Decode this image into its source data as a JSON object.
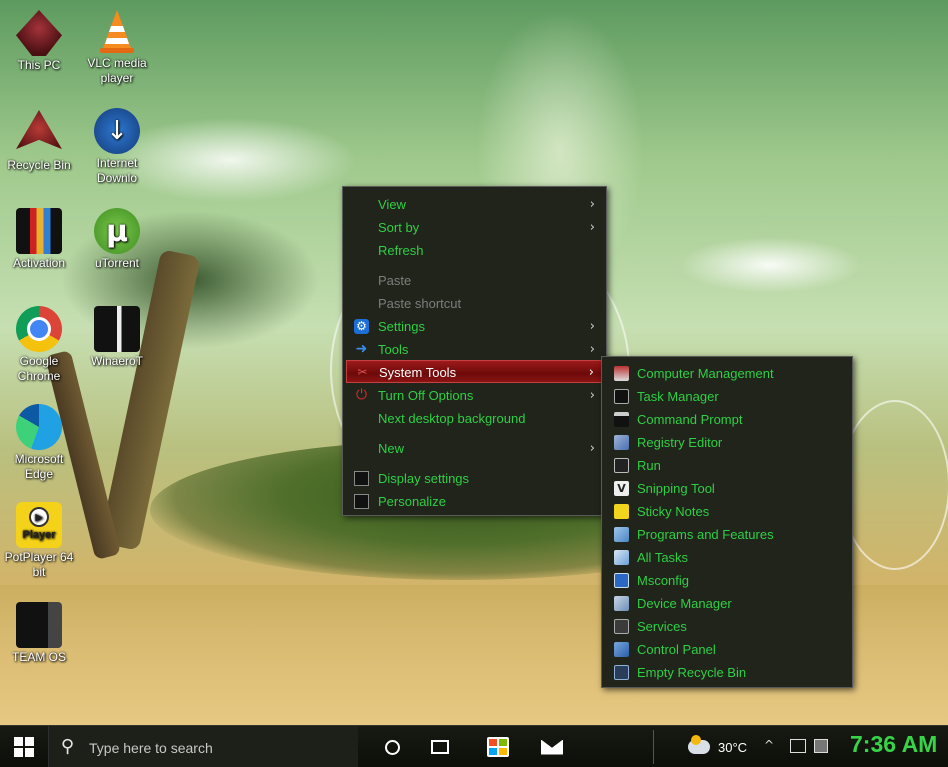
{
  "desktop": {
    "icons": [
      {
        "label": "This PC",
        "icon": "this-pc-icon"
      },
      {
        "label": "VLC media player",
        "icon": "vlc-icon"
      },
      {
        "label": "Recycle Bin",
        "icon": "recycle-bin-icon"
      },
      {
        "label": "Internet Downlo",
        "icon": "internet-download-manager-icon"
      },
      {
        "label": "Activation",
        "icon": "activation-icon"
      },
      {
        "label": "uTorrent",
        "icon": "utorrent-icon"
      },
      {
        "label": "Google Chrome",
        "icon": "chrome-icon"
      },
      {
        "label": "WinaeroT",
        "icon": "winaero-icon"
      },
      {
        "label": "Microsoft Edge",
        "icon": "edge-icon"
      },
      {
        "label": "PotPlayer 64 bit",
        "icon": "potplayer-icon",
        "badge": "Player"
      },
      {
        "label": "TEAM OS",
        "icon": "team-os-icon"
      }
    ]
  },
  "context_menu": {
    "items": [
      {
        "label": "View",
        "submenu": true
      },
      {
        "label": "Sort by",
        "submenu": true
      },
      {
        "label": "Refresh"
      },
      {
        "label": "Paste",
        "disabled": true
      },
      {
        "label": "Paste shortcut",
        "disabled": true
      },
      {
        "label": "Settings",
        "submenu": true,
        "icon": "gear-icon"
      },
      {
        "label": "Tools",
        "submenu": true,
        "icon": "arrow-right-icon"
      },
      {
        "label": "System Tools",
        "submenu": true,
        "selected": true,
        "icon": "tools-icon"
      },
      {
        "label": "Turn Off Options",
        "submenu": true,
        "icon": "power-icon"
      },
      {
        "label": "Next desktop background"
      },
      {
        "label": "New",
        "submenu": true
      },
      {
        "label": "Display settings",
        "icon": "display-icon"
      },
      {
        "label": "Personalize",
        "icon": "personalize-icon"
      }
    ],
    "arrow_glyph": "›"
  },
  "system_tools_submenu": {
    "items": [
      {
        "label": "Computer Management",
        "icon": "computer-management-icon"
      },
      {
        "label": "Task Manager",
        "icon": "task-manager-icon"
      },
      {
        "label": "Command Prompt",
        "icon": "command-prompt-icon"
      },
      {
        "label": "Registry Editor",
        "icon": "registry-editor-icon"
      },
      {
        "label": "Run",
        "icon": "run-icon"
      },
      {
        "label": "Snipping Tool",
        "icon": "snipping-tool-icon"
      },
      {
        "label": "Sticky Notes",
        "icon": "sticky-notes-icon"
      },
      {
        "label": "Programs and Features",
        "icon": "programs-features-icon"
      },
      {
        "label": "All Tasks",
        "icon": "all-tasks-icon"
      },
      {
        "label": "Msconfig",
        "icon": "msconfig-icon"
      },
      {
        "label": "Device Manager",
        "icon": "device-manager-icon"
      },
      {
        "label": "Services",
        "icon": "services-icon"
      },
      {
        "label": "Control Panel",
        "icon": "control-panel-icon"
      },
      {
        "label": "Empty Recycle Bin",
        "icon": "empty-recycle-bin-icon"
      }
    ]
  },
  "taskbar": {
    "search_placeholder": "Type here to search",
    "weather_temp": "30°C",
    "clock": "7:36 AM",
    "chevron": "^"
  },
  "colors": {
    "menu_bg": "#20241b",
    "menu_text": "#2fcf44",
    "menu_disabled": "#7d7d7d",
    "selected_bg": "#8a1414",
    "clock_color": "#37d447"
  }
}
